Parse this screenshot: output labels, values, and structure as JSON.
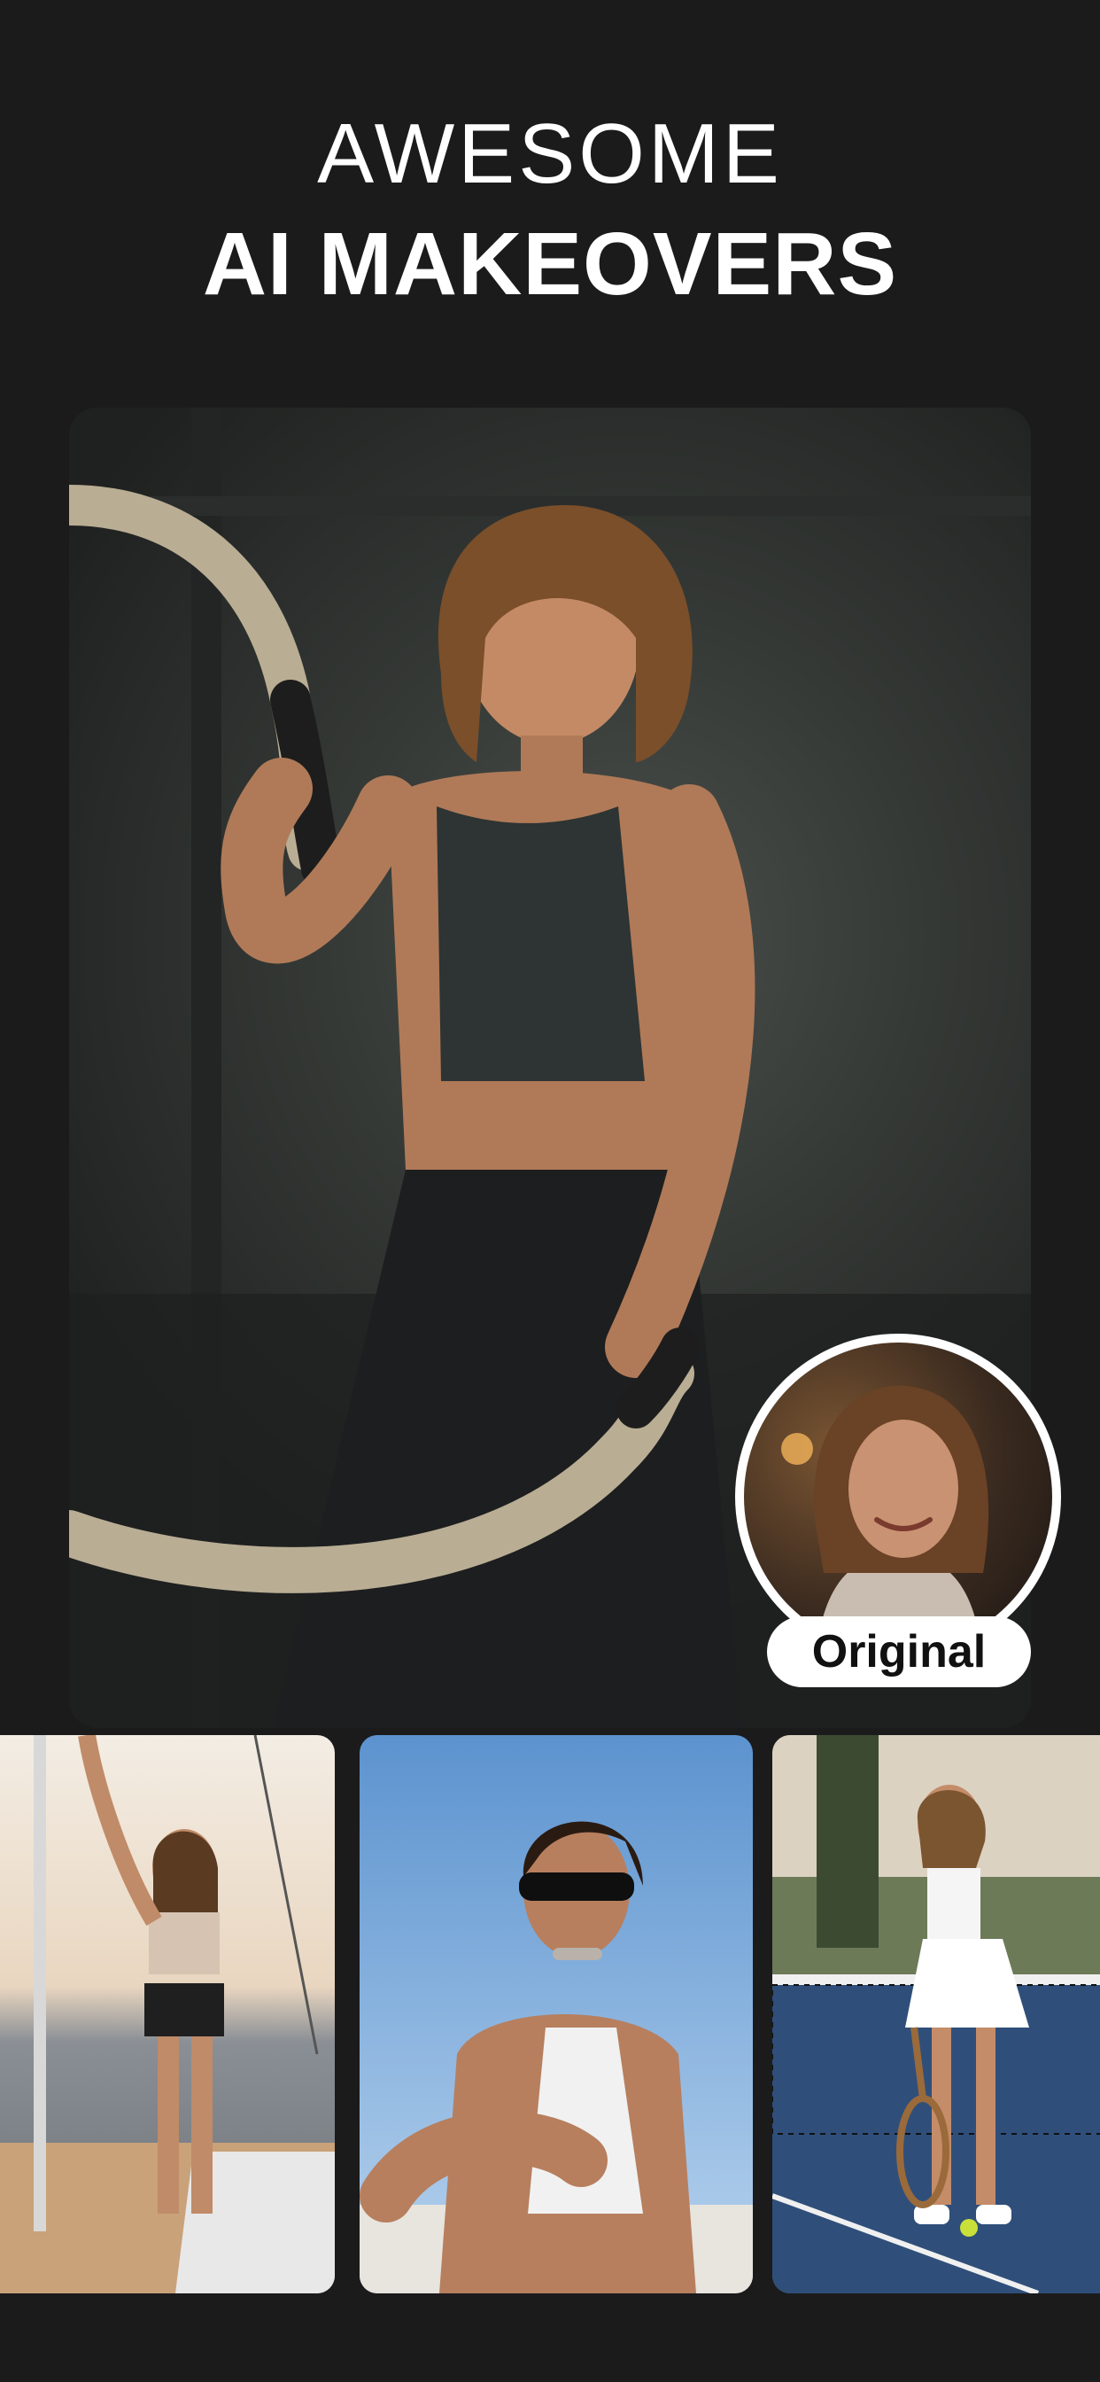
{
  "headline": {
    "line1": "AWESOME",
    "line2": "AI MAKEOVERS"
  },
  "hero_image": {
    "subject": "woman with battle ropes in gym"
  },
  "original_badge": {
    "label": "Original",
    "subject": "smiling woman portrait"
  },
  "thumbnails": [
    {
      "subject": "woman on sailboat deck at sunset"
    },
    {
      "subject": "woman in swimsuit and sunglasses"
    },
    {
      "subject": "woman on tennis court"
    }
  ],
  "colors": {
    "background": "#1b1b1c",
    "text": "#ffffff",
    "pill": "#ffffff"
  }
}
